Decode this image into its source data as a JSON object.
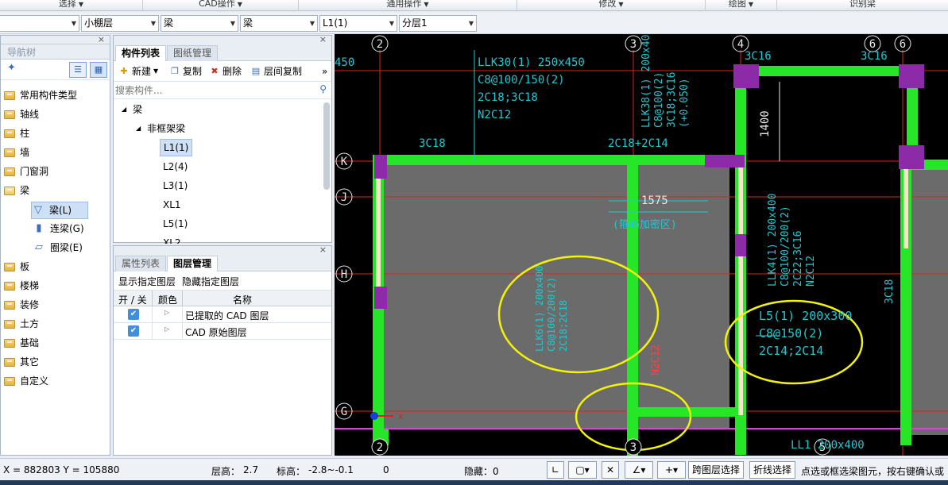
{
  "ribbon": {
    "groups": [
      {
        "label": "选择",
        "has_caret": true
      },
      {
        "label": "CAD操作",
        "has_caret": true
      },
      {
        "label": "通用操作",
        "has_caret": true
      },
      {
        "label": "修改",
        "has_caret": true
      },
      {
        "label": "绘图",
        "has_caret": true
      },
      {
        "label": "识别梁",
        "has_caret": false
      }
    ]
  },
  "selector_bar": {
    "floor": "小棚层",
    "category": "梁",
    "type": "梁",
    "component": "L1(1)",
    "layer": "分层1"
  },
  "nav_tree": {
    "title": "导航树",
    "items": [
      "常用构件类型",
      "轴线",
      "柱",
      "墙",
      "门窗洞",
      "梁",
      "板",
      "楼梯",
      "装修",
      "土方",
      "基础",
      "其它",
      "自定义"
    ],
    "beam_children": [
      "梁(L)",
      "连梁(G)",
      "圈梁(E)"
    ]
  },
  "component_panel": {
    "tabs": [
      "构件列表",
      "图纸管理"
    ],
    "toolbar": {
      "new": "新建",
      "copy": "复制",
      "delete": "删除",
      "floor_copy": "层间复制"
    },
    "search_placeholder": "搜索构件...",
    "root": "梁",
    "group": "非框架梁",
    "items": [
      "L1(1)",
      "L2(4)",
      "L3(1)",
      "XL1",
      "L5(1)",
      "XL2"
    ],
    "selected": "L1(1)"
  },
  "layer_panel": {
    "tabs": [
      "属性列表",
      "图层管理"
    ],
    "show_layer": "显示指定图层",
    "hide_layer": "隐藏指定图层",
    "columns": [
      "开 / 关",
      "颜色",
      "名称"
    ],
    "rows": [
      {
        "checked": true,
        "name": "已提取的 CAD 图层"
      },
      {
        "checked": true,
        "name": "CAD 原始图层"
      }
    ]
  },
  "cad_canvas": {
    "axis_top": [
      "2",
      "3",
      "4",
      "6",
      "6"
    ],
    "axis_left": [
      "K",
      "J",
      "H",
      "G"
    ],
    "axis_bottom": [
      "2",
      "3",
      "5"
    ],
    "annotations": {
      "llk30": [
        "LLK30(1) 250x450",
        "C8@100/150(2)",
        "2C18;3C18",
        "N2C12"
      ],
      "llk38": [
        "LLK38(1) 200x400",
        "C8@100(2)",
        "3C18;3C16",
        "(+0.050)"
      ],
      "llk4": [
        "LLK4(1) 200x400",
        "C8@100/200(2)",
        "2C22;3C16",
        "N2C12"
      ],
      "l5": [
        "L5(1) 200x300",
        "C8@150(2)",
        "2C14;2C14"
      ],
      "llk_mid": [
        "LLK6(1) 200x400",
        "C8@100/200(2)",
        "2C18;2C18"
      ],
      "bottom_right": "LL1 200x400",
      "c3c18_top": "3C18",
      "c2c18_top": "2C18+2C14",
      "c3c16_a": "3C16",
      "c3c16_b": "3C16",
      "dim_1575": "1575",
      "dim_1400": "1400",
      "dense_zone": "(箍筋加密区)",
      "n2c12_mid": "N2C12",
      "c3c18_right": "3C18",
      "partial_450": "450"
    }
  },
  "status_bar": {
    "coords": "X = 882803 Y = 105880",
    "floor_height_label": "层高：",
    "floor_height": "2.7",
    "elevation_label": "标高：",
    "elevation": "-2.8~-0.1",
    "count": "0",
    "hidden": "隐藏：0",
    "cross_layer_btn": "跨图层选择",
    "polyline_btn": "折线选择",
    "hint": "点选或框选梁图元，按右键确认或"
  },
  "colors": {
    "beam_green": "#27e627",
    "column_purple": "#8c2aa8",
    "axis_red": "#e02020",
    "cad_gray": "#6b6b6b",
    "highlight_yellow": "#f2f20a",
    "text_cyan": "#20c8d0",
    "magenta_line": "#ff2bff"
  }
}
